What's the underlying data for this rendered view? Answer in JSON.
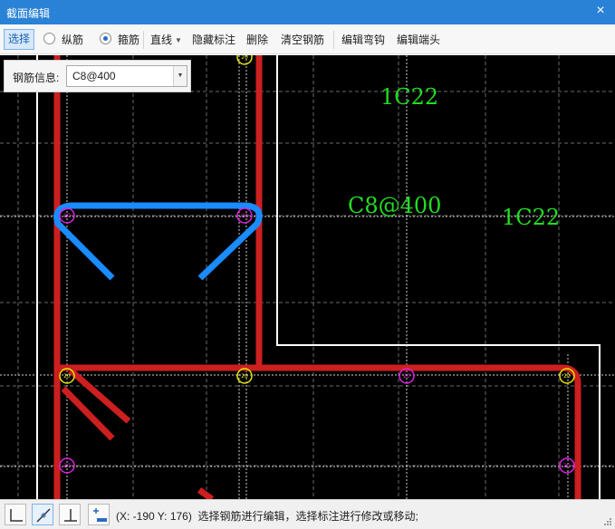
{
  "window": {
    "title": "截面编辑",
    "close_label": "×"
  },
  "toolbar": {
    "select_label": "选择",
    "longitudinal_label": "纵筋",
    "stirrup_label": "箍筋",
    "line_label": "直线",
    "hide_labels": "隐藏标注",
    "delete_label": "删除",
    "clear_label": "清空钢筋",
    "edit_hook": "编辑弯钩",
    "edit_end": "编辑端头",
    "selected_mode": "箍筋"
  },
  "rebar_info": {
    "label": "钢筋信息:",
    "value": "C8@400"
  },
  "canvas": {
    "annotations": [
      {
        "id": "top",
        "text": "1C22"
      },
      {
        "id": "stirrup",
        "text": "C8@400"
      },
      {
        "id": "right",
        "text": "1C22"
      }
    ],
    "point_marker": "20",
    "colors": {
      "background": "#000000",
      "stirrup_red": "#cc1f1f",
      "selected_blue": "#1a8cff",
      "annotation_green": "#22dd22",
      "point_yellow": "#e6e600",
      "point_magenta": "#e020e0",
      "outline_white": "#ffffff"
    }
  },
  "status": {
    "coords": "(X: -190 Y: 176)",
    "message": "选择钢筋进行编辑，选择标注进行修改或移动;",
    "buttons": [
      {
        "name": "corner-snap-icon"
      },
      {
        "name": "diagonal-snap-icon"
      },
      {
        "name": "perpendicular-snap-icon"
      },
      {
        "name": "add-offset-icon"
      }
    ]
  }
}
